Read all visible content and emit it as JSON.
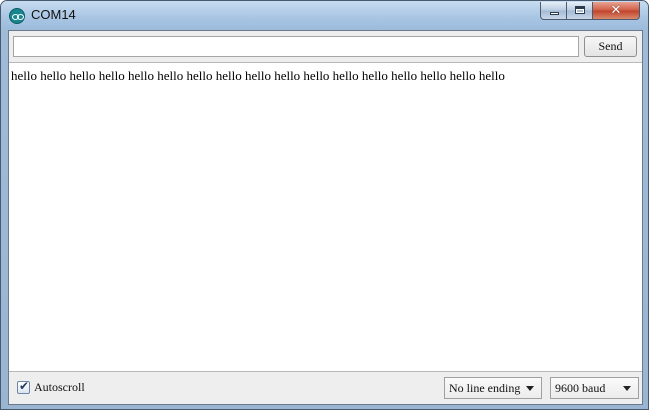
{
  "window": {
    "title": "COM14",
    "app_icon": "arduino-icon",
    "controls": {
      "minimize_icon": "minimize-icon",
      "maximize_icon": "maximize-icon",
      "close_glyph": "✕"
    }
  },
  "send_bar": {
    "input_value": "",
    "send_label": "Send"
  },
  "output": {
    "lines": [
      "hello hello hello hello hello hello hello hello hello hello hello hello hello hello hello hello hello"
    ]
  },
  "footer": {
    "autoscroll_label": "Autoscroll",
    "autoscroll_checked": true,
    "checkmark": "✔",
    "line_ending": "No line ending",
    "baud_rate": "9600 baud"
  }
}
